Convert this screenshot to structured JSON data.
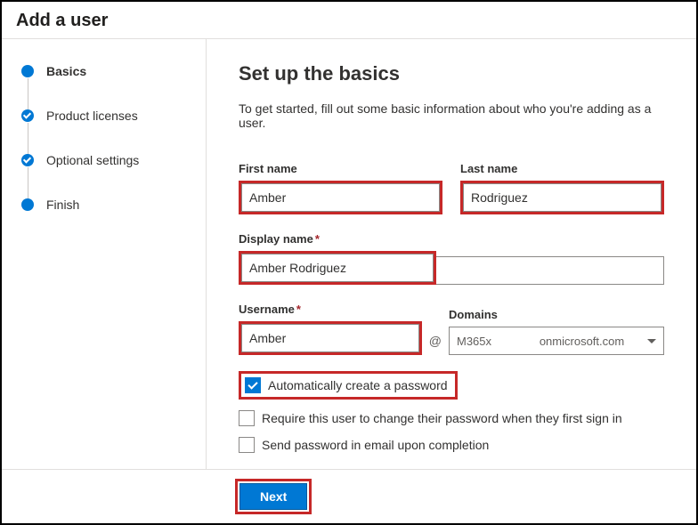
{
  "header": {
    "title": "Add a user"
  },
  "steps": [
    {
      "label": "Basics",
      "state": "active",
      "dot": "solid"
    },
    {
      "label": "Product licenses",
      "state": "done",
      "dot": "check"
    },
    {
      "label": "Optional settings",
      "state": "done",
      "dot": "check"
    },
    {
      "label": "Finish",
      "state": "todo",
      "dot": "solid"
    }
  ],
  "main": {
    "heading": "Set up the basics",
    "intro": "To get started, fill out some basic information about who you're adding as a user.",
    "labels": {
      "first_name": "First name",
      "last_name": "Last name",
      "display_name": "Display name",
      "username": "Username",
      "domains": "Domains"
    },
    "values": {
      "first_name": "Amber",
      "last_name": "Rodriguez",
      "display_name": "Amber Rodriguez",
      "username": "Amber",
      "domain_prefix": "M365x",
      "domain_suffix": "onmicrosoft.com"
    },
    "at_symbol": "@",
    "required_mark": "*",
    "checkboxes": {
      "auto_pw": {
        "label": "Automatically create a password",
        "checked": true
      },
      "require_change": {
        "label": "Require this user to change their password when they first sign in",
        "checked": false
      },
      "send_email": {
        "label": "Send password in email upon completion",
        "checked": false
      }
    }
  },
  "footer": {
    "next": "Next"
  }
}
